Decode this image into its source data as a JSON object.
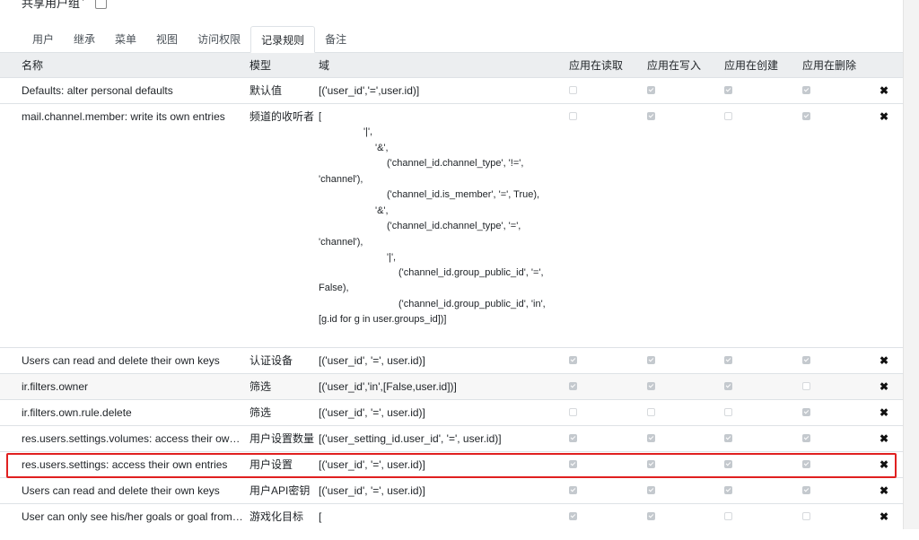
{
  "shared_group": {
    "label": "共享用户组",
    "help": "?"
  },
  "tabs": [
    {
      "label": "用户"
    },
    {
      "label": "继承"
    },
    {
      "label": "菜单"
    },
    {
      "label": "视图"
    },
    {
      "label": "访问权限"
    },
    {
      "label": "记录规则"
    },
    {
      "label": "备注"
    }
  ],
  "active_tab": "记录规则",
  "columns": {
    "name": "名称",
    "model": "模型",
    "domain": "域",
    "read": "应用在读取",
    "write": "应用在写入",
    "create": "应用在创建",
    "unlink": "应用在删除"
  },
  "delete_symbol": "✖",
  "rows": [
    {
      "name": "Defaults: alter personal defaults",
      "model": "默认值",
      "domain": "[('user_id','=',user.id)]",
      "read": false,
      "write": true,
      "create": true,
      "unlink": true
    },
    {
      "name": "mail.channel.member: write its own entries",
      "model": "频道的收听者",
      "domain_lines": [
        "[",
        "'|',",
        "'&',",
        "('channel_id.channel_type', '!=',",
        "'channel'),",
        "('channel_id.is_member', '=', True),",
        "'&',",
        "('channel_id.channel_type', '=',",
        "'channel'),",
        "'|',",
        "('channel_id.group_public_id', '=',",
        "False),",
        "('channel_id.group_public_id', 'in',",
        "[g.id for g in user.groups_id])]"
      ],
      "read": false,
      "write": true,
      "create": false,
      "unlink": true
    },
    {
      "name": "Users can read and delete their own keys",
      "model": "认证设备",
      "domain": "[('user_id', '=', user.id)]",
      "read": true,
      "write": true,
      "create": true,
      "unlink": true
    },
    {
      "name": "ir.filters.owner",
      "model": "筛选",
      "domain": "[('user_id','in',[False,user.id])]",
      "read": true,
      "write": true,
      "create": true,
      "unlink": false
    },
    {
      "name": "ir.filters.own.rule.delete",
      "model": "筛选",
      "domain": "[('user_id', '=', user.id)]",
      "read": false,
      "write": false,
      "create": false,
      "unlink": true
    },
    {
      "name": "res.users.settings.volumes: access their own en...",
      "model": "用户设置数量",
      "domain": "[('user_setting_id.user_id', '=', user.id)]",
      "read": true,
      "write": true,
      "create": true,
      "unlink": true
    },
    {
      "name": "res.users.settings: access their own entries",
      "model": "用户设置",
      "domain": "[('user_id', '=', user.id)]",
      "read": true,
      "write": true,
      "create": true,
      "unlink": true
    },
    {
      "name": "Users can read and delete their own keys",
      "model": "用户API密钥",
      "domain": "[('user_id', '=', user.id)]",
      "read": true,
      "write": true,
      "create": true,
      "unlink": true
    },
    {
      "name": "User can only see his/her goals or goal from th...",
      "model": "游戏化目标",
      "domain": "[",
      "read": true,
      "write": true,
      "create": false,
      "unlink": false
    }
  ]
}
